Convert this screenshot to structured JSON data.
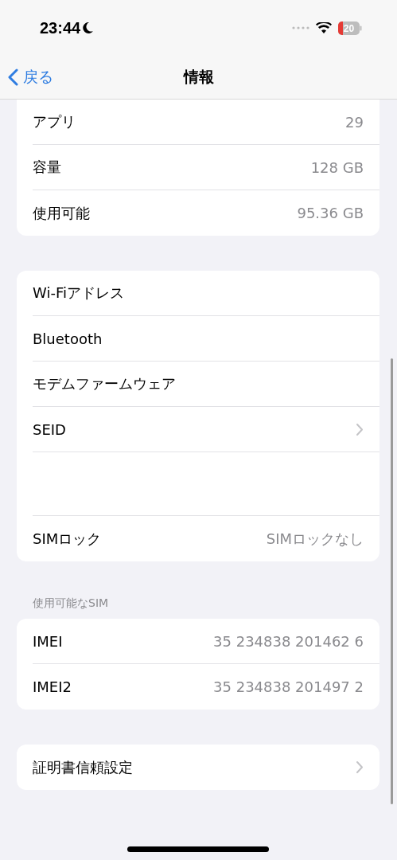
{
  "status_bar": {
    "time": "23:44",
    "battery": "20"
  },
  "nav": {
    "back": "戻る",
    "title": "情報"
  },
  "groups": [
    {
      "cut_top": true,
      "rows": [
        {
          "kind": "value",
          "label": "アプリ",
          "value": "29"
        },
        {
          "kind": "value",
          "label": "容量",
          "value": "128 GB"
        },
        {
          "kind": "value",
          "label": "使用可能",
          "value": "95.36 GB"
        }
      ]
    },
    {
      "rows": [
        {
          "kind": "value",
          "label": "Wi-Fiアドレス"
        },
        {
          "kind": "value",
          "label": "Bluetooth"
        },
        {
          "kind": "value",
          "label": "モデムファームウェア"
        },
        {
          "kind": "link",
          "label": "SEID"
        },
        {
          "kind": "hidden"
        },
        {
          "kind": "value",
          "label": "SIMロック",
          "value": "SIMロックなし"
        }
      ]
    },
    {
      "header": "使用可能なSIM",
      "rows": [
        {
          "kind": "value",
          "label": "IMEI",
          "value": "35 234838 201462 6"
        },
        {
          "kind": "value",
          "label": "IMEI2",
          "value": "35 234838 201497 2"
        }
      ]
    },
    {
      "rows": [
        {
          "kind": "link",
          "label": "証明書信頼設定"
        }
      ]
    }
  ]
}
